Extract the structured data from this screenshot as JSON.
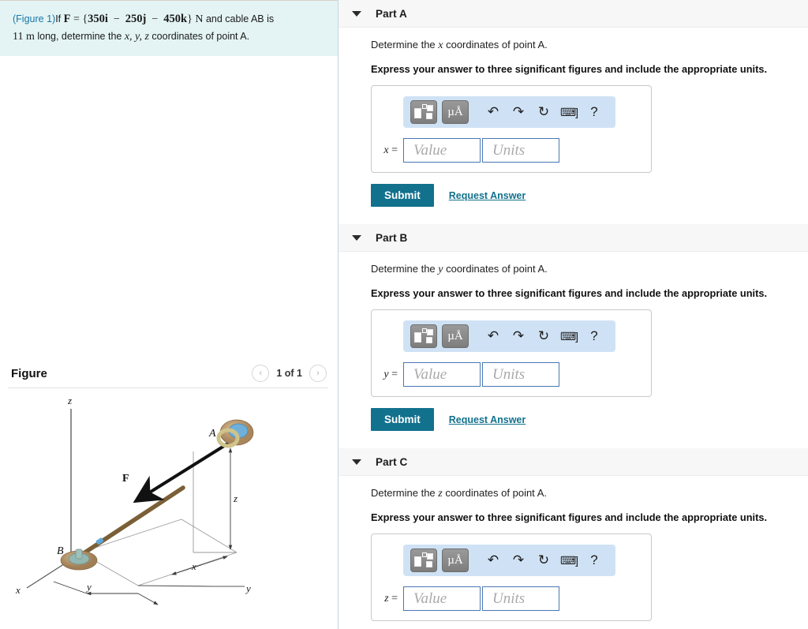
{
  "problem": {
    "figure_ref": "(Figure 1)",
    "text_lead": "If ",
    "force_expr": "F = {350i − 250j − 450k} N",
    "text_mid": " and cable AB is",
    "text_line2_a": "11 m",
    "text_line2_b": " long, determine the ",
    "text_line2_vars": "x, y, z",
    "text_line2_c": " coordinates of point A.",
    "force_symbol": "F",
    "equals": "=",
    "brace_open": "{",
    "i_term": "350i",
    "minus1": "−",
    "j_term": "250j",
    "minus2": "−",
    "k_term": "450k",
    "brace_close": "}",
    "unit_newton": "N"
  },
  "figure_panel": {
    "title": "Figure",
    "prev_icon": "chevron-left-icon",
    "next_icon": "chevron-right-icon",
    "prev_glyph": "‹",
    "next_glyph": "›",
    "count_label": "1 of 1",
    "diagram": {
      "labels": {
        "axis_z_top": "z",
        "axis_x_left": "x",
        "axis_y_mid": "y",
        "axis_y_right": "y",
        "point_a": "A",
        "point_b": "B",
        "force": "F",
        "dim_z": "z",
        "dim_x": "x",
        "dim_y": "y"
      },
      "colors": {
        "cable": "#8a6c47",
        "arrow": "#111111",
        "anchor_base": "#c8a678",
        "anchor_inner": "#7fb6d6",
        "ring": "#d9cf9a",
        "fitting": "#8fb3ad",
        "axis_line": "#6a6a6a",
        "dim_line": "#8c8c8c"
      }
    }
  },
  "toolbar": {
    "template_icon": "math-template-icon",
    "units_icon": "units-icon",
    "units_label": "μÅ",
    "units_mu": "μ",
    "units_angstrom": "Å",
    "undo_icon": "undo-icon",
    "undo_glyph": "↶",
    "redo_icon": "redo-icon",
    "redo_glyph": "↷",
    "reset_icon": "reset-icon",
    "reset_glyph": "↻",
    "keyboard_icon": "keyboard-icon",
    "keyboard_glyph": "⌨",
    "bracket_glyph": "]",
    "help_icon": "help-icon",
    "help_glyph": "?"
  },
  "common": {
    "instruction": "Express your answer to three significant figures and include the appropriate units.",
    "value_placeholder": "Value",
    "units_placeholder": "Units",
    "submit_label": "Submit",
    "request_answer_label": "Request Answer",
    "equals_sign": "=",
    "collapse_icon": "caret-down-icon"
  },
  "parts": [
    {
      "id": "part-a",
      "title": "Part A",
      "prompt_pre": "Determine the ",
      "prompt_var": "x",
      "prompt_post": " coordinates of point A.",
      "variable": "x",
      "has_submit": true
    },
    {
      "id": "part-b",
      "title": "Part B",
      "prompt_pre": "Determine the ",
      "prompt_var": "y",
      "prompt_post": " coordinates of point A.",
      "variable": "y",
      "has_submit": true
    },
    {
      "id": "part-c",
      "title": "Part C",
      "prompt_pre": "Determine the ",
      "prompt_var": "z",
      "prompt_post": " coordinates of point A.",
      "variable": "z",
      "has_submit": false
    }
  ],
  "colors": {
    "problem_bg": "#e4f4f4",
    "toolbar_bg": "#cfe2f5",
    "submit_bg": "#12718d",
    "link": "#12718d",
    "field_border": "#4a77b4",
    "part_header_bg": "#f7f7f7",
    "figref": "#1976a8"
  }
}
